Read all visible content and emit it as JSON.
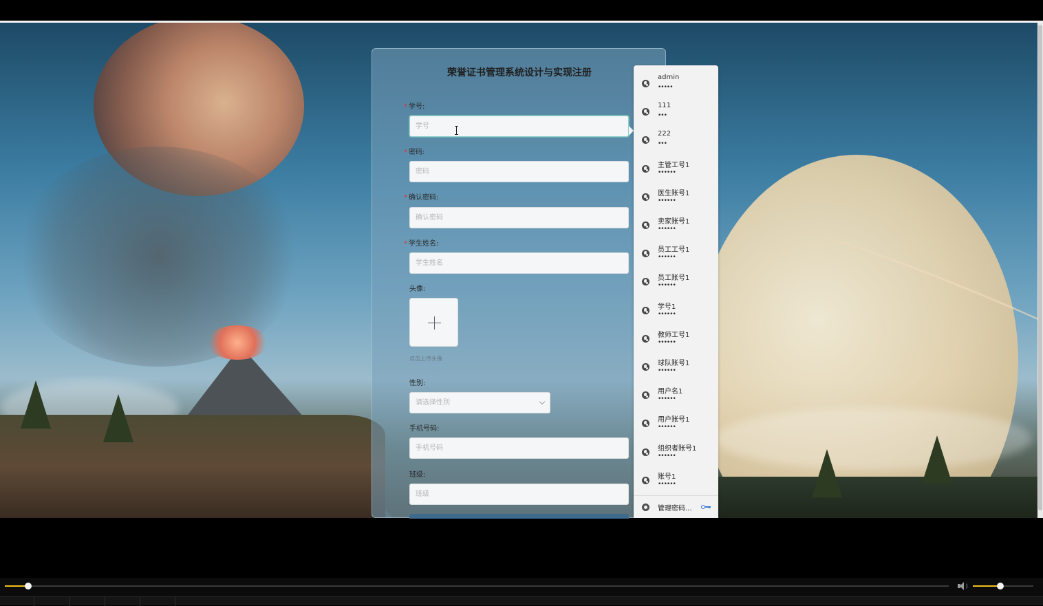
{
  "register_form": {
    "title": "荣誉证书管理系统设计与实现注册",
    "fields": {
      "student_id": {
        "label": "学号:",
        "placeholder": "学号",
        "required": true
      },
      "password": {
        "label": "密码:",
        "placeholder": "密码",
        "required": true
      },
      "confirm_password": {
        "label": "确认密码:",
        "placeholder": "确认密码",
        "required": true
      },
      "student_name": {
        "label": "学生姓名:",
        "placeholder": "学生姓名",
        "required": true
      },
      "avatar": {
        "label": "头像:",
        "tip": "点击上传头像"
      },
      "gender": {
        "label": "性别:",
        "placeholder": "请选择性别"
      },
      "phone": {
        "label": "手机号码:",
        "placeholder": "手机号码"
      },
      "class": {
        "label": "班级:",
        "placeholder": "班级"
      }
    },
    "required_mark": "*"
  },
  "autofill": {
    "credentials": [
      {
        "username": "admin",
        "password_mask": "•••••"
      },
      {
        "username": "111",
        "password_mask": "•••"
      },
      {
        "username": "222",
        "password_mask": "•••"
      },
      {
        "username": "主管工号1",
        "password_mask": "••••••"
      },
      {
        "username": "医生账号1",
        "password_mask": "••••••"
      },
      {
        "username": "卖家账号1",
        "password_mask": "••••••"
      },
      {
        "username": "员工工号1",
        "password_mask": "••••••"
      },
      {
        "username": "员工账号1",
        "password_mask": "••••••"
      },
      {
        "username": "学号1",
        "password_mask": "••••••"
      },
      {
        "username": "教师工号1",
        "password_mask": "••••••"
      },
      {
        "username": "球队账号1",
        "password_mask": "••••••"
      },
      {
        "username": "用户名1",
        "password_mask": "••••••"
      },
      {
        "username": "用户账号1",
        "password_mask": "••••••"
      },
      {
        "username": "组织者账号1",
        "password_mask": "••••••"
      },
      {
        "username": "账号1",
        "password_mask": "••••••"
      }
    ],
    "manage_label": "管理密码..."
  },
  "player": {
    "seek_progress": 0.025,
    "volume": 0.45,
    "accent_color": "#f0c020"
  }
}
